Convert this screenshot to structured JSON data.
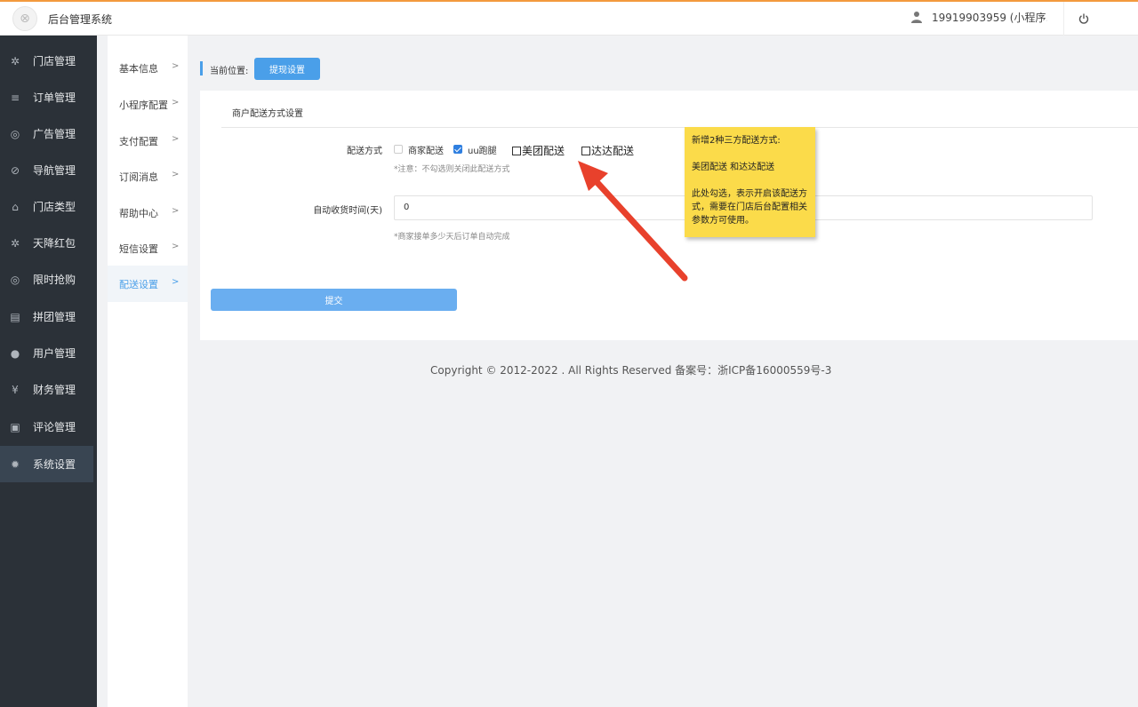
{
  "header": {
    "app_title": "后台管理系统",
    "user_name": "19919903959 (小程序…",
    "accent_color": "#f39a3d"
  },
  "sidebar": {
    "items": [
      {
        "label": "门店管理",
        "icon": "store-icon"
      },
      {
        "label": "订单管理",
        "icon": "list-icon"
      },
      {
        "label": "广告管理",
        "icon": "lifebuoy-icon"
      },
      {
        "label": "导航管理",
        "icon": "compass-icon"
      },
      {
        "label": "门店类型",
        "icon": "bank-icon"
      },
      {
        "label": "天降红包",
        "icon": "gift-icon"
      },
      {
        "label": "限时抢购",
        "icon": "lifebuoy-icon"
      },
      {
        "label": "拼团管理",
        "icon": "news-icon"
      },
      {
        "label": "用户管理",
        "icon": "user-icon"
      },
      {
        "label": "财务管理",
        "icon": "yen-icon"
      },
      {
        "label": "评论管理",
        "icon": "money-icon"
      },
      {
        "label": "系统设置",
        "icon": "gear-icon",
        "active": true
      }
    ]
  },
  "submenu": {
    "items": [
      {
        "label": "基本信息"
      },
      {
        "label": "小程序配置"
      },
      {
        "label": "支付配置"
      },
      {
        "label": "订阅消息"
      },
      {
        "label": "帮助中心"
      },
      {
        "label": "短信设置"
      },
      {
        "label": "配送设置",
        "active": true
      }
    ]
  },
  "breadcrumb": {
    "label": "当前位置:",
    "current": "提现设置"
  },
  "panel": {
    "title": "商户配送方式设置",
    "delivery": {
      "label": "配送方式",
      "options": [
        {
          "label": "商家配送",
          "checked": false
        },
        {
          "label": "uu跑腿",
          "checked": true
        },
        {
          "label": "美团配送",
          "checked": false
        },
        {
          "label": "达达配送",
          "checked": false
        }
      ],
      "hint": "*注意：不勾选则关闭此配送方式"
    },
    "auto_receive": {
      "label": "自动收货时间(天)",
      "value": "0",
      "hint": "*商家接单多少天后订单自动完成"
    },
    "submit_label": "提交"
  },
  "note": {
    "line1": "新增2种三方配送方式:",
    "line2": "美团配送 和达达配送",
    "line3": "此处勾选，表示开启该配送方式，需要在门店后台配置相关参数方可使用。"
  },
  "footer": {
    "text": "Copyright © 2012-2022 . All Rights Reserved 备案号：浙ICP备16000559号-3"
  }
}
